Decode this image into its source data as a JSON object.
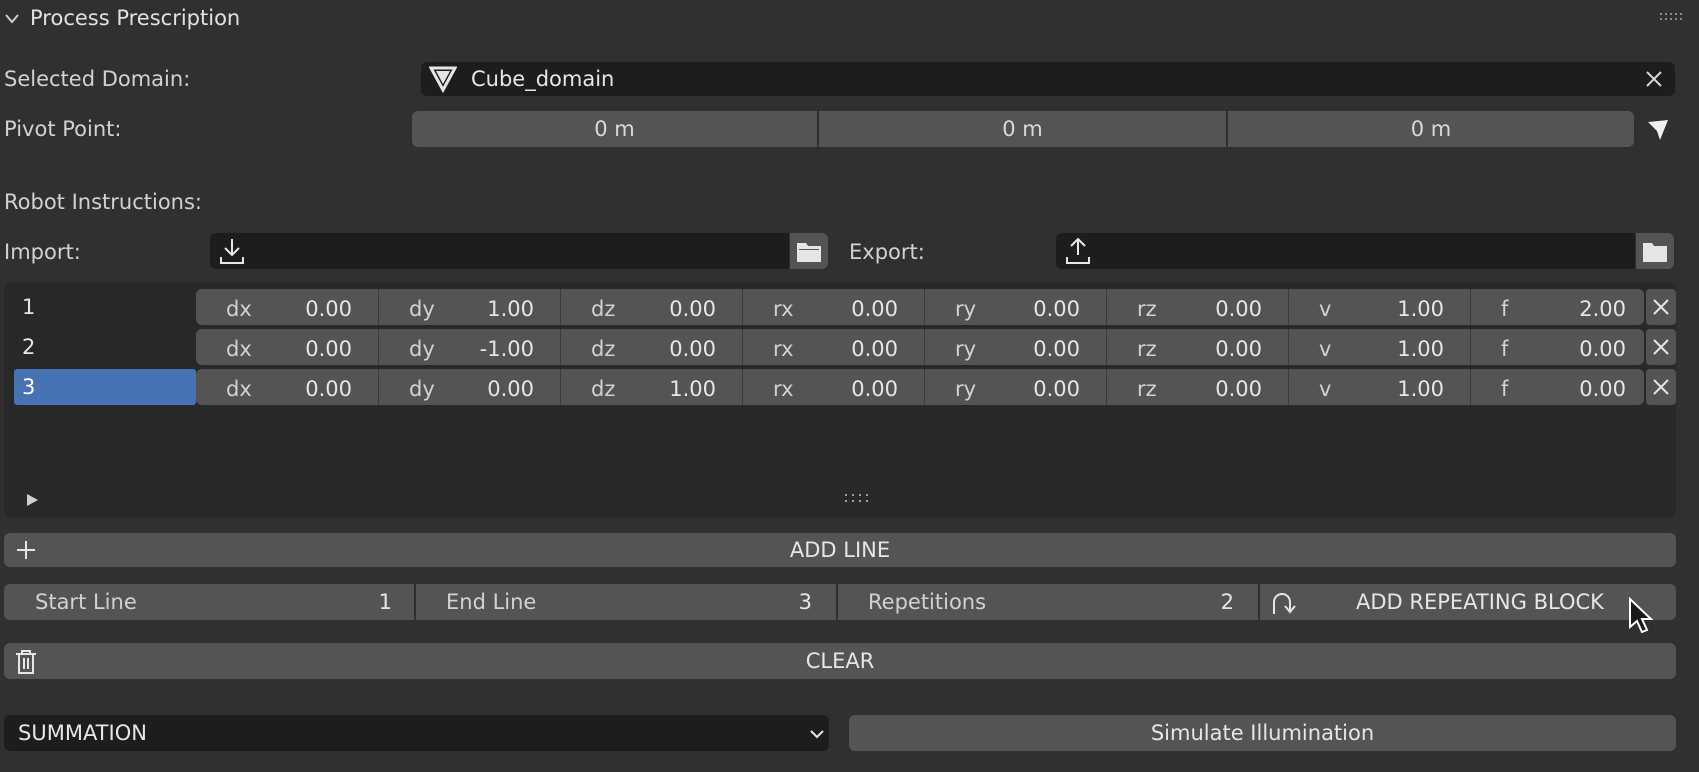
{
  "panel": {
    "title": "Process Prescription"
  },
  "domain": {
    "label": "Selected Domain:",
    "value": "Cube_domain"
  },
  "pivot": {
    "label": "Pivot Point:",
    "x": "0 m",
    "y": "0 m",
    "z": "0 m"
  },
  "robot": {
    "label": "Robot Instructions:"
  },
  "import": {
    "label": "Import:",
    "value": ""
  },
  "export": {
    "label": "Export:",
    "value": ""
  },
  "rows": [
    {
      "num": "1",
      "cells": [
        [
          "dx",
          "0.00"
        ],
        [
          "dy",
          "1.00"
        ],
        [
          "dz",
          "0.00"
        ],
        [
          "rx",
          "0.00"
        ],
        [
          "ry",
          "0.00"
        ],
        [
          "rz",
          "0.00"
        ],
        [
          "v",
          "1.00"
        ],
        [
          "f",
          "2.00"
        ]
      ],
      "selected": false
    },
    {
      "num": "2",
      "cells": [
        [
          "dx",
          "0.00"
        ],
        [
          "dy",
          "-1.00"
        ],
        [
          "dz",
          "0.00"
        ],
        [
          "rx",
          "0.00"
        ],
        [
          "ry",
          "0.00"
        ],
        [
          "rz",
          "0.00"
        ],
        [
          "v",
          "1.00"
        ],
        [
          "f",
          "0.00"
        ]
      ],
      "selected": false
    },
    {
      "num": "3",
      "cells": [
        [
          "dx",
          "0.00"
        ],
        [
          "dy",
          "0.00"
        ],
        [
          "dz",
          "1.00"
        ],
        [
          "rx",
          "0.00"
        ],
        [
          "ry",
          "0.00"
        ],
        [
          "rz",
          "0.00"
        ],
        [
          "v",
          "1.00"
        ],
        [
          "f",
          "0.00"
        ]
      ],
      "selected": true
    }
  ],
  "add_line": {
    "label": "ADD LINE"
  },
  "repeat": {
    "start_label": "Start Line",
    "start_value": "1",
    "end_label": "End Line",
    "end_value": "3",
    "rep_label": "Repetitions",
    "rep_value": "2",
    "button_label": "ADD REPEATING BLOCK"
  },
  "clear": {
    "label": "CLEAR"
  },
  "mode": {
    "value": "SUMMATION"
  },
  "simulate": {
    "label": "Simulate Illumination"
  },
  "colors": {
    "background": "#303030",
    "field": "#545454",
    "dark_field": "#1d1d1d",
    "selection": "#4772b3"
  }
}
